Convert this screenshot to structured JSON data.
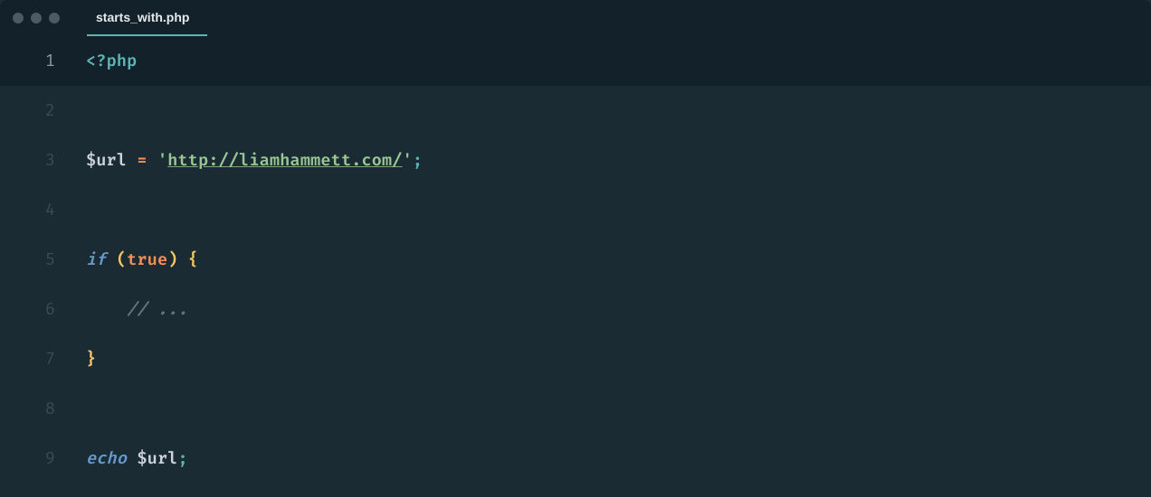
{
  "tab": {
    "filename": "starts_with.php"
  },
  "gutter": {
    "l1": "1",
    "l2": "2",
    "l3": "3",
    "l4": "4",
    "l5": "5",
    "l6": "6",
    "l7": "7",
    "l8": "8",
    "l9": "9"
  },
  "code": {
    "l1": {
      "open": "<?",
      "php": "php"
    },
    "l3": {
      "var": "$url",
      "sp1": " ",
      "eq": "=",
      "sp2": " ",
      "q1": "'",
      "url": "http://liamhammett.com/",
      "q2": "'",
      "semi": ";"
    },
    "l5": {
      "if": "if",
      "sp": " ",
      "lp": "(",
      "true": "true",
      "rp": ")",
      "sp2": " ",
      "lb": "{"
    },
    "l6": {
      "indent": "    ",
      "cmt": "// ..."
    },
    "l7": {
      "rb": "}"
    },
    "l9": {
      "echo": "echo",
      "sp": " ",
      "var": "$url",
      "semi": ";"
    }
  }
}
